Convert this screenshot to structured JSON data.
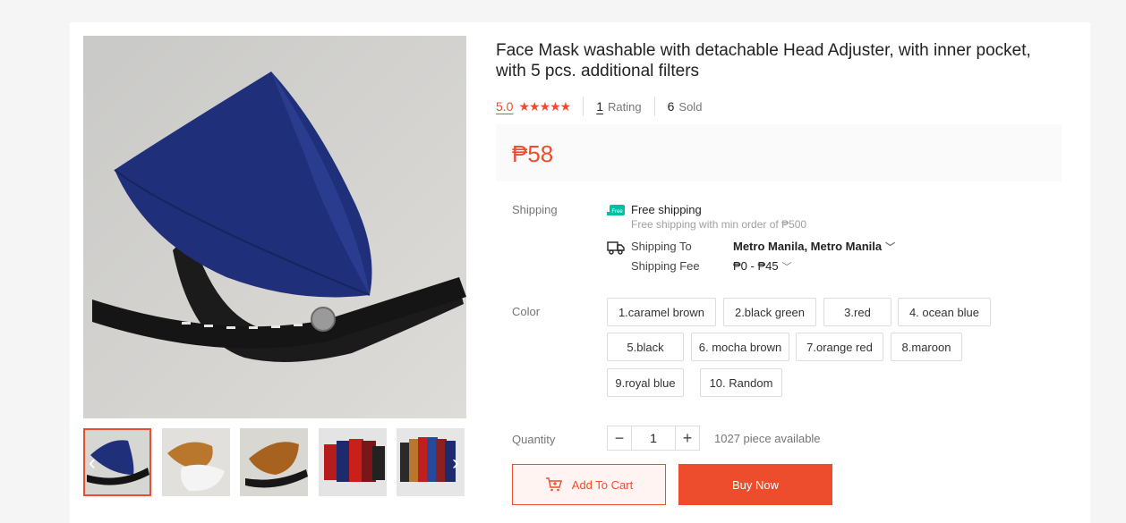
{
  "product": {
    "title": "Face Mask washable with detachable Head Adjuster, with inner pocket, with 5 pcs. additional filters",
    "rating_value": "5.0",
    "stars": "★★★★★",
    "rating_count": "1",
    "rating_label": "Rating",
    "sold_count": "6",
    "sold_label": "Sold",
    "price": "₱58"
  },
  "shipping": {
    "label": "Shipping",
    "free_badge": "Free",
    "free_title": "Free shipping",
    "free_note": "Free shipping with min order of ₱500",
    "ship_to_label": "Shipping To",
    "ship_to_value": "Metro Manila, Metro Manila",
    "fee_label": "Shipping Fee",
    "fee_value": "₱0 - ₱45"
  },
  "color": {
    "label": "Color",
    "options": [
      "1.caramel brown",
      "2.black green",
      "3.red",
      "4. ocean blue",
      "5.black",
      "6. mocha brown",
      "7.orange red",
      "8.maroon",
      "9.royal blue",
      "10. Random"
    ]
  },
  "quantity": {
    "label": "Quantity",
    "minus": "−",
    "value": "1",
    "plus": "+",
    "available": "1027 piece available"
  },
  "actions": {
    "add_to_cart": "Add To Cart",
    "buy_now": "Buy Now"
  },
  "gallery": {
    "prev_icon": "‹",
    "next_icon": "›"
  },
  "colors": {
    "accent": "#ee4d2d",
    "teal": "#00bfa5"
  }
}
